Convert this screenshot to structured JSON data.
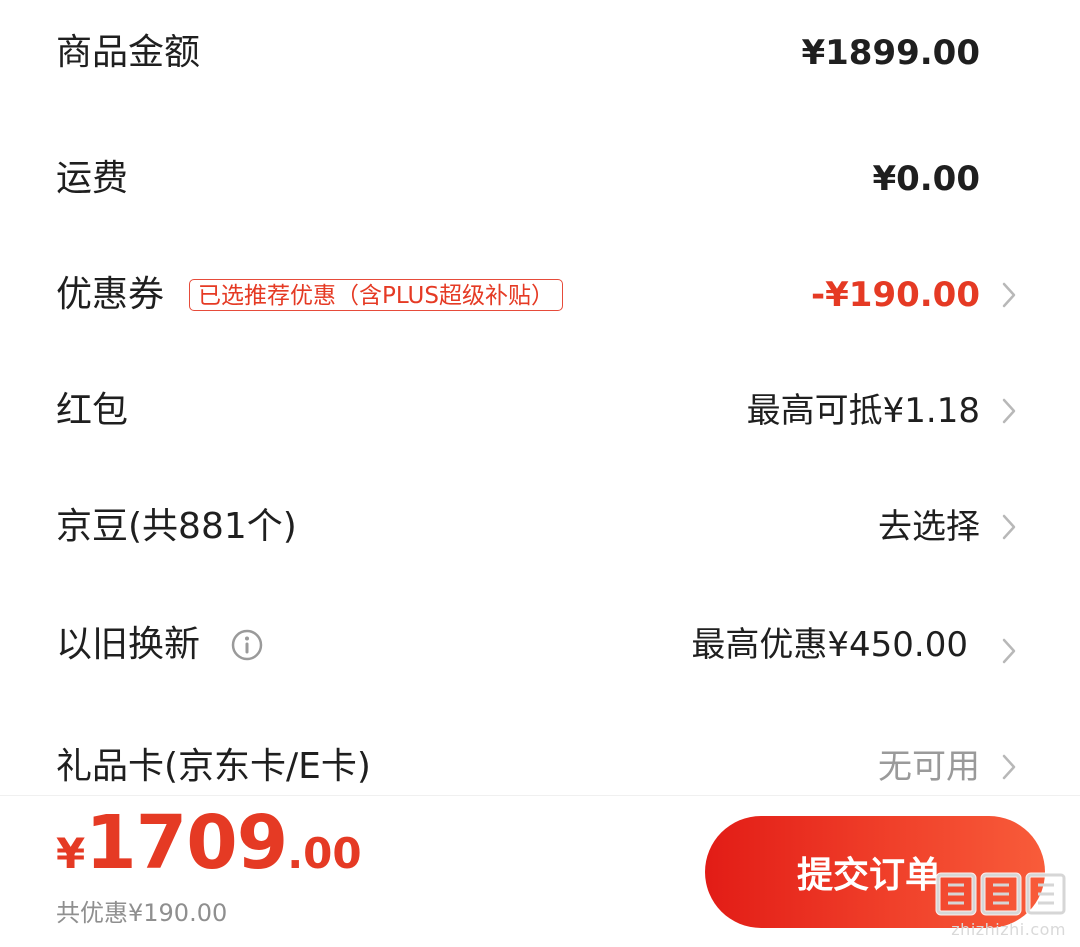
{
  "rows": {
    "goods_amount": {
      "label": "商品金额",
      "value": "¥1899.00"
    },
    "shipping": {
      "label": "运费",
      "value": "¥0.00"
    },
    "coupon": {
      "label": "优惠券",
      "tag": "已选推荐优惠（含PLUS超级补贴）",
      "value": "-¥190.00"
    },
    "red_packet": {
      "label": "红包",
      "value": "最高可抵¥1.18"
    },
    "jingdou": {
      "label": "京豆(共881个)",
      "value": "去选择"
    },
    "trade_in": {
      "label": "以旧换新",
      "value": "最高优惠¥450.00"
    },
    "gift_card": {
      "label": "礼品卡(京东卡/E卡)",
      "value": "无可用"
    }
  },
  "footer": {
    "total": {
      "currency": "¥",
      "integer": "1709",
      "decimal": ".00"
    },
    "saved_text": "共优惠¥190.00",
    "submit_label": "提交订单"
  },
  "watermark": {
    "text": "zhizhizhi.com"
  },
  "icons": {
    "chevron": "chevron-right-icon",
    "info": "info-circle-icon",
    "watermark": "watermark-logo-icon"
  },
  "colors": {
    "accent_red": "#e53a24",
    "muted_gray": "#9a9a9a",
    "text_dark": "#1f1f1f",
    "button_gradient_start": "#e21c16",
    "button_gradient_end": "#f85c3a"
  }
}
